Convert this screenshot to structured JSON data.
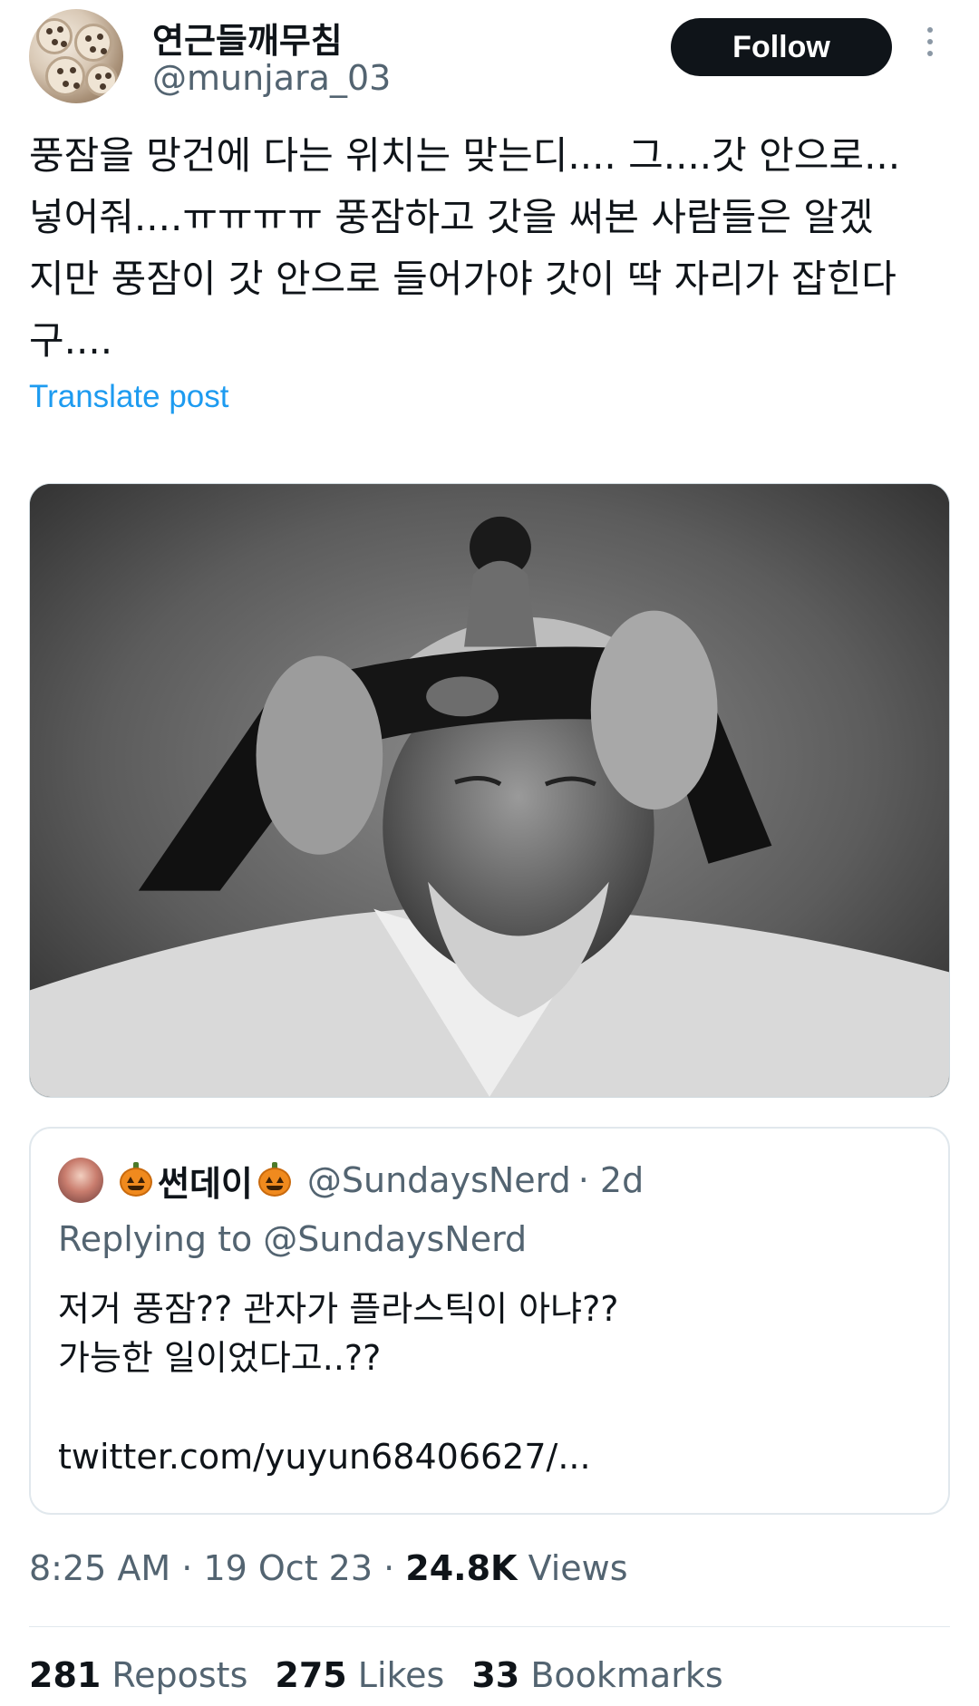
{
  "author": {
    "display_name": "연근들깨무침",
    "handle": "@munjara_03",
    "follow_label": "Follow"
  },
  "tweet": {
    "text": "풍잠을 망건에 다는 위치는 맞는디.... 그....갓 안으로...\n넣어줘....ㅠㅠㅠㅠ 풍잠하고 갓을 써본 사람들은 알겠\n지만 풍잠이 갓 안으로 들어가야 갓이 딱 자리가 잡힌다\n구....",
    "translate_label": "Translate post"
  },
  "quoted": {
    "display_name": "썬데이",
    "handle": "@SundaysNerd",
    "time": "· 2d",
    "replying_to": "Replying to @SundaysNerd",
    "text": "저거 풍잠?? 관자가 플라스틱이 아냐??\n가능한 일이었다고..??",
    "link": "twitter.com/yuyun68406627/..."
  },
  "meta": {
    "time": "8:25 AM",
    "sep1": " · ",
    "date": "19 Oct 23",
    "sep2": " · ",
    "views_count": "24.8K",
    "views_label": " Views"
  },
  "stats": {
    "reposts_count": "281",
    "reposts_label": "Reposts",
    "likes_count": "275",
    "likes_label": "Likes",
    "bookmarks_count": "33",
    "bookmarks_label": "Bookmarks"
  }
}
